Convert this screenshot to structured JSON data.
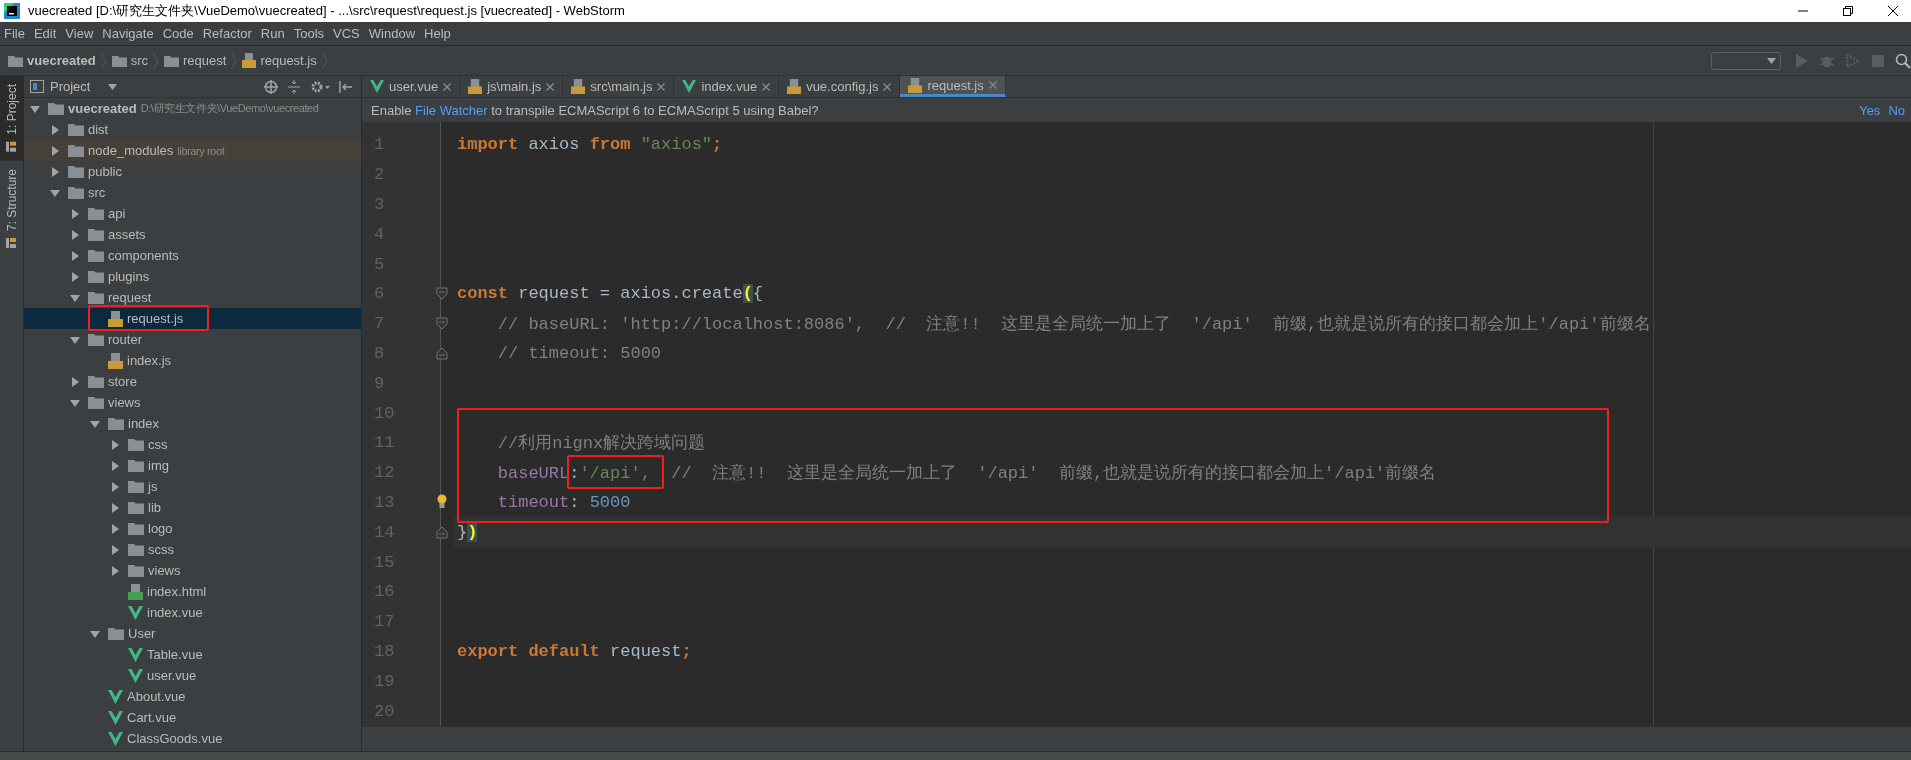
{
  "window": {
    "title": "vuecreated [D:\\研究生文件夹\\VueDemo\\vuecreated] - ...\\src\\request\\request.js [vuecreated] - WebStorm"
  },
  "menu": [
    "File",
    "Edit",
    "View",
    "Navigate",
    "Code",
    "Refactor",
    "Run",
    "Tools",
    "VCS",
    "Window",
    "Help"
  ],
  "breadcrumbs": [
    {
      "label": "vuecreated",
      "kind": "project"
    },
    {
      "label": "src",
      "kind": "folder"
    },
    {
      "label": "request",
      "kind": "folder"
    },
    {
      "label": "request.js",
      "kind": "js"
    }
  ],
  "tool_stripe": [
    {
      "label": "1: Project",
      "selected": true
    },
    {
      "label": "7: Structure",
      "selected": false
    }
  ],
  "project_panel": {
    "title": "Project",
    "tree": [
      {
        "label": "vuecreated",
        "kind": "project",
        "hint": "D:\\研究生文件夹\\VueDemo\\vuecreated",
        "expanded": true,
        "selected": false,
        "children": [
          {
            "label": "dist",
            "kind": "folder",
            "expanded": false,
            "selected": false
          },
          {
            "label": "node_modules",
            "kind": "folder",
            "hint": "library root",
            "library": true,
            "expanded": false,
            "selected": false
          },
          {
            "label": "public",
            "kind": "folder",
            "expanded": false,
            "selected": false
          },
          {
            "label": "src",
            "kind": "folder",
            "expanded": true,
            "selected": false,
            "children": [
              {
                "label": "api",
                "kind": "folder",
                "expanded": false,
                "selected": false
              },
              {
                "label": "assets",
                "kind": "folder",
                "expanded": false,
                "selected": false
              },
              {
                "label": "components",
                "kind": "folder",
                "expanded": false,
                "selected": false
              },
              {
                "label": "plugins",
                "kind": "folder",
                "expanded": false,
                "selected": false
              },
              {
                "label": "request",
                "kind": "folder",
                "expanded": true,
                "selected": false,
                "children": [
                  {
                    "label": "request.js",
                    "kind": "js",
                    "selected": true,
                    "boxed": true
                  }
                ]
              },
              {
                "label": "router",
                "kind": "folder",
                "expanded": true,
                "selected": false,
                "children": [
                  {
                    "label": "index.js",
                    "kind": "js",
                    "selected": false
                  }
                ]
              },
              {
                "label": "store",
                "kind": "folder",
                "expanded": false,
                "selected": false
              },
              {
                "label": "views",
                "kind": "folder",
                "expanded": true,
                "selected": false,
                "children": [
                  {
                    "label": "index",
                    "kind": "folder",
                    "expanded": true,
                    "selected": false,
                    "children": [
                      {
                        "label": "css",
                        "kind": "folder",
                        "expanded": false,
                        "selected": false
                      },
                      {
                        "label": "img",
                        "kind": "folder",
                        "expanded": false,
                        "selected": false
                      },
                      {
                        "label": "js",
                        "kind": "folder",
                        "expanded": false,
                        "selected": false
                      },
                      {
                        "label": "lib",
                        "kind": "folder",
                        "expanded": false,
                        "selected": false
                      },
                      {
                        "label": "logo",
                        "kind": "folder",
                        "expanded": false,
                        "selected": false
                      },
                      {
                        "label": "scss",
                        "kind": "folder",
                        "expanded": false,
                        "selected": false
                      },
                      {
                        "label": "views",
                        "kind": "folder",
                        "expanded": false,
                        "selected": false
                      },
                      {
                        "label": "index.html",
                        "kind": "html",
                        "selected": false
                      },
                      {
                        "label": "index.vue",
                        "kind": "vue",
                        "selected": false
                      }
                    ]
                  },
                  {
                    "label": "User",
                    "kind": "folder",
                    "expanded": true,
                    "selected": false,
                    "children": [
                      {
                        "label": "Table.vue",
                        "kind": "vue",
                        "selected": false
                      },
                      {
                        "label": "user.vue",
                        "kind": "vue",
                        "selected": false
                      }
                    ]
                  },
                  {
                    "label": "About.vue",
                    "kind": "vue",
                    "selected": false
                  },
                  {
                    "label": "Cart.vue",
                    "kind": "vue",
                    "selected": false
                  },
                  {
                    "label": "ClassGoods.vue",
                    "kind": "vue",
                    "selected": false
                  }
                ]
              }
            ]
          }
        ]
      }
    ]
  },
  "tabs": [
    {
      "label": "user.vue",
      "kind": "vue",
      "selected": false
    },
    {
      "label": "js\\main.js",
      "kind": "js",
      "selected": false
    },
    {
      "label": "src\\main.js",
      "kind": "js",
      "selected": false
    },
    {
      "label": "index.vue",
      "kind": "vue",
      "selected": false
    },
    {
      "label": "vue.config.js",
      "kind": "js",
      "selected": false
    },
    {
      "label": "request.js",
      "kind": "js",
      "selected": true
    }
  ],
  "notification": {
    "before": "Enable ",
    "link": "File Watcher",
    "after": " to transpile ECMAScript 6 to ECMAScript 5 using Babel?",
    "actions": [
      "Yes",
      "No"
    ]
  },
  "editor": {
    "lines": [
      {
        "number": "1",
        "tokens": [
          {
            "kind": "kw",
            "text": "import"
          },
          {
            "kind": "pl",
            "text": " axios "
          },
          {
            "kind": "kw",
            "text": "from"
          },
          {
            "kind": "str",
            "text": " \"axios\""
          },
          {
            "kind": "kw",
            "text": ";"
          }
        ]
      },
      {
        "number": "2"
      },
      {
        "number": "3"
      },
      {
        "number": "4"
      },
      {
        "number": "5"
      },
      {
        "number": "6",
        "fold_start": true,
        "tokens": [
          {
            "kind": "kw",
            "text": "const"
          },
          {
            "kind": "pl",
            "text": " request = axios.create"
          },
          {
            "kind": "brace",
            "text": "("
          },
          {
            "kind": "pl",
            "text": "{"
          }
        ]
      },
      {
        "number": "7",
        "fold_start": true,
        "tokens": [
          {
            "kind": "cm",
            "text": "    // baseURL: 'http://localhost:8086',  //  注意!!  这里是全局统一加上了  '/api'  前缀,也就是说所有的接口都会加上'/api'前缀名"
          }
        ]
      },
      {
        "number": "8",
        "fold_end": true,
        "tokens": [
          {
            "kind": "cm",
            "text": "    // timeout: 5000"
          }
        ]
      },
      {
        "number": "9"
      },
      {
        "number": "10"
      },
      {
        "number": "11",
        "boxed": true,
        "tokens": [
          {
            "kind": "cm",
            "text": "    //利用nignx解决跨域问题"
          }
        ]
      },
      {
        "number": "12",
        "boxed": true,
        "tokens": [
          {
            "kind": "prop",
            "text": "    baseURL"
          },
          {
            "kind": "pl",
            "text": ":"
          },
          {
            "kind": "str",
            "text": "'/api',",
            "boxed": true
          },
          {
            "kind": "cm",
            "text": "  //  注意!!  这里是全局统一加上了  '/api'  前缀,也就是说所有的接口都会加上'/api'前缀名"
          }
        ]
      },
      {
        "number": "13",
        "boxed": true,
        "bulb": true,
        "tokens": [
          {
            "kind": "prop",
            "text": "    timeout"
          },
          {
            "kind": "pl",
            "text": ": "
          },
          {
            "kind": "num",
            "text": "5000"
          }
        ]
      },
      {
        "number": "14",
        "fold_end": true,
        "current": true,
        "tokens": [
          {
            "kind": "pl",
            "text": "}"
          },
          {
            "kind": "brace",
            "text": ")"
          }
        ]
      },
      {
        "number": "15"
      },
      {
        "number": "16"
      },
      {
        "number": "17"
      },
      {
        "number": "18",
        "tokens": [
          {
            "kind": "kw",
            "text": "export default"
          },
          {
            "kind": "pl",
            "text": " request"
          },
          {
            "kind": "kw",
            "text": ";"
          }
        ]
      },
      {
        "number": "19"
      },
      {
        "number": "20"
      }
    ]
  }
}
